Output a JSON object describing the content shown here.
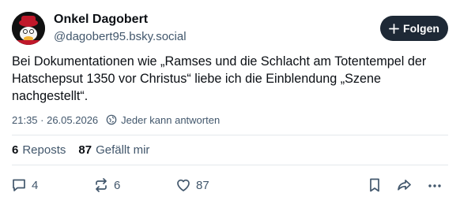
{
  "author": {
    "display_name": "Onkel Dagobert",
    "handle": "@dagobert95.bsky.social"
  },
  "follow_button": {
    "label": "Folgen"
  },
  "post": {
    "text": "Bei Dokumentationen wie „Ramses und die Schlacht am Totentempel der Hatschepsut 1350 vor Christus“ liebe ich die Einblendung „Szene nachgestellt“.",
    "timestamp": "21:35 · 26.05.2026",
    "reply_setting": "Jeder kann antworten"
  },
  "stats": {
    "reposts_count": "6",
    "reposts_label": "Reposts",
    "likes_count": "87",
    "likes_label": "Gefällt mir"
  },
  "actions": {
    "reply_count": "4",
    "repost_count": "6",
    "like_count": "87"
  },
  "icons": {
    "follow": "plus-icon",
    "reply_setting": "globe-icon",
    "reply": "speech-bubble-icon",
    "repost": "repost-arrows-icon",
    "like": "heart-icon",
    "bookmark": "bookmark-icon",
    "share": "share-arrow-icon",
    "more": "ellipsis-icon"
  },
  "colors": {
    "text": "#0b0f14",
    "muted": "#42576c",
    "follow_bg": "#1e2936",
    "divider": "#e4e8ec"
  }
}
